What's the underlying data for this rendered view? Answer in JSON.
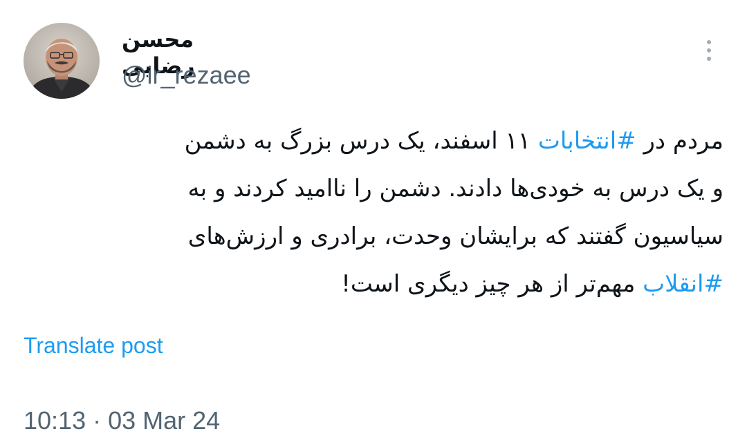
{
  "author": {
    "display_name": "محسن رضایی",
    "handle": "@ir_rezaee",
    "avatar_icon": "profile-photo"
  },
  "menu": {
    "icon": "more-vertical-icon"
  },
  "post": {
    "lines": [
      {
        "pre": "مردم در ",
        "hashtag": "#انتخابات",
        "post": " ۱۱ اسفند، یک درس بزرگ به دشمن"
      },
      {
        "text": "و یک درس به خودی‌ها دادند. دشمن را ناامید کردند و به"
      },
      {
        "text": "سیاسیون گفتند که برایشان وحدت، برادری و ارزش‌های"
      },
      {
        "pre": "",
        "hashtag": "#انقلاب",
        "post": " مهم‌تر از هر چیز دیگری است!"
      }
    ]
  },
  "translate_label": "Translate post",
  "timestamp": "10:13 · 03 Mar 24",
  "colors": {
    "link": "#1d9bf0",
    "secondary_text": "#536471",
    "primary_text": "#0f1419"
  }
}
